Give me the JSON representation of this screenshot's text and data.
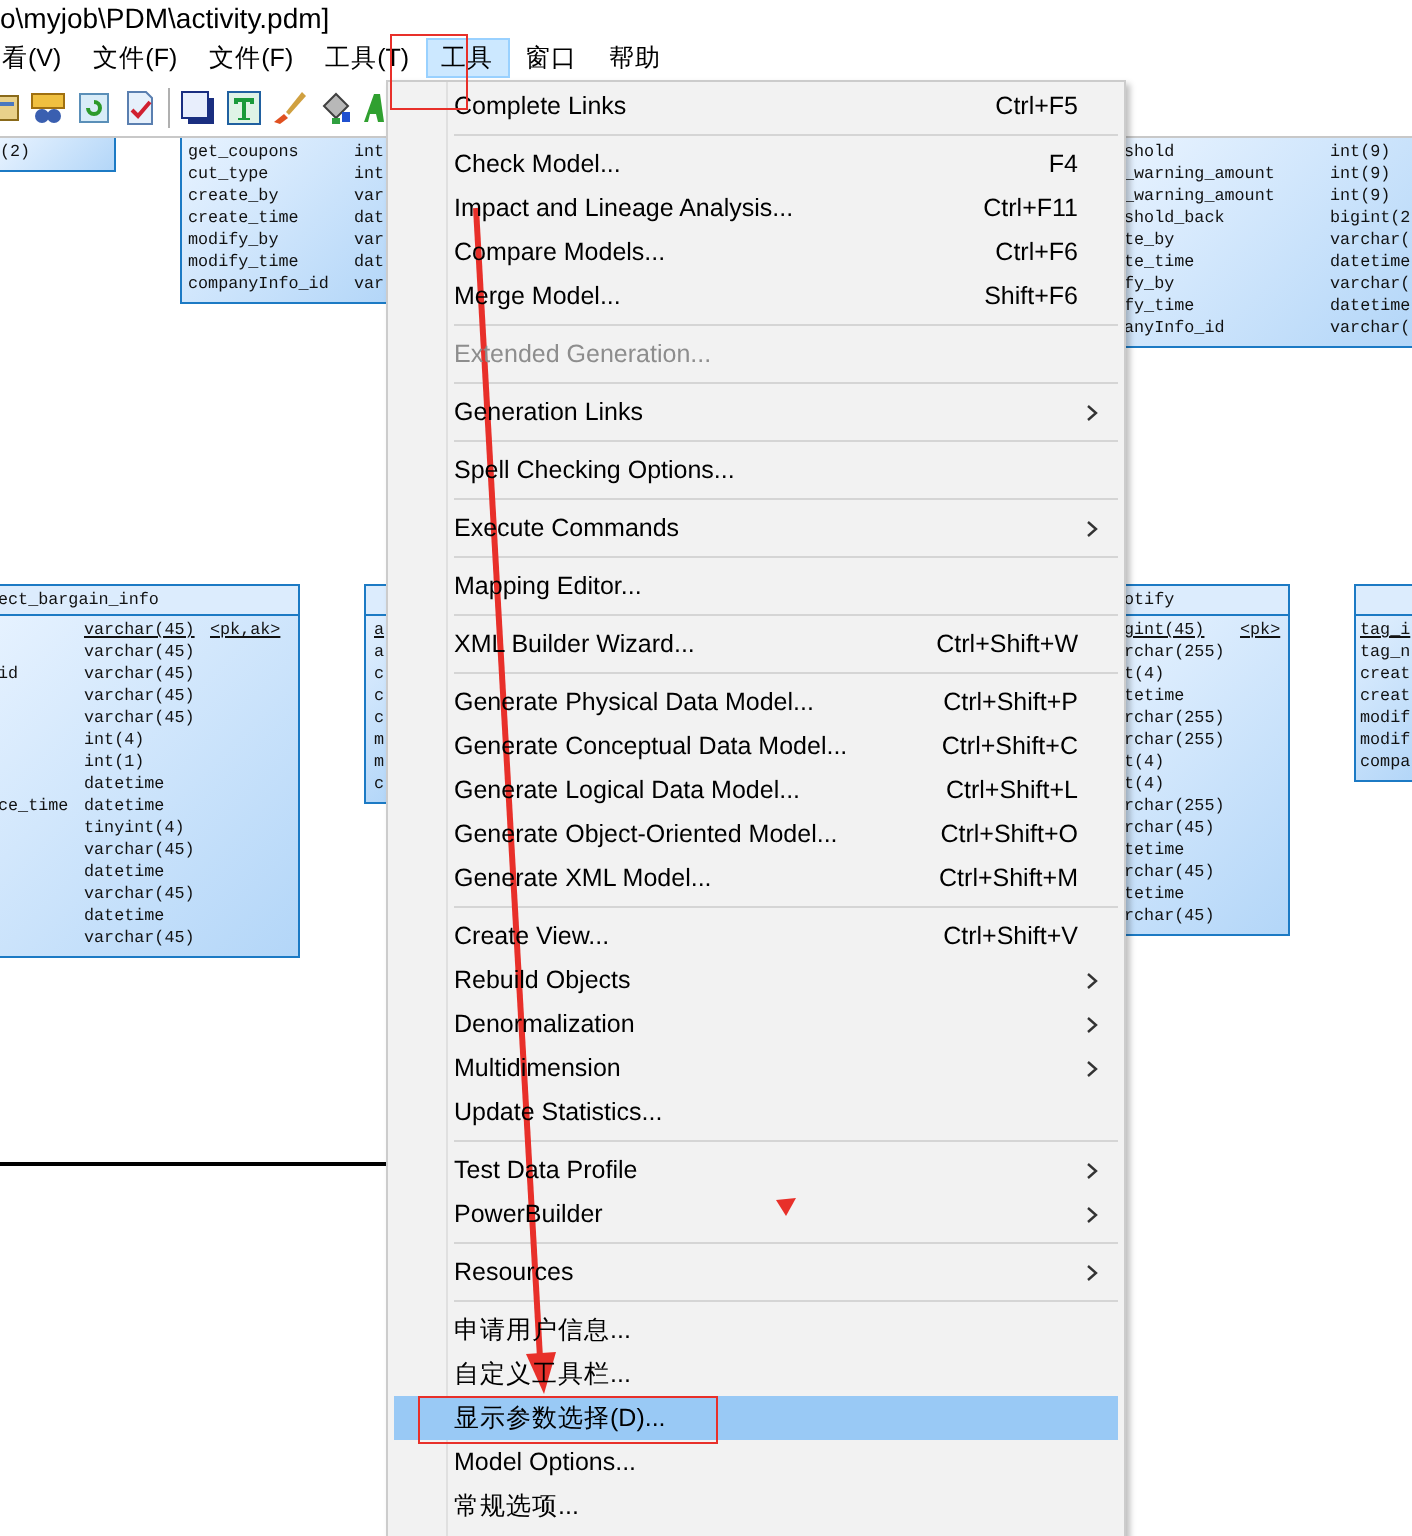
{
  "window": {
    "title": "o\\myjob\\PDM\\activity.pdm]"
  },
  "menu_bar": [
    {
      "label": "看(V)",
      "selected": false
    },
    {
      "label": "文件(F)",
      "selected": false
    },
    {
      "label": "文件(F)",
      "selected": false
    },
    {
      "label": "工具(T)",
      "selected": false
    },
    {
      "label": "工具",
      "selected": true
    },
    {
      "label": "窗口",
      "selected": false
    },
    {
      "label": "帮助",
      "selected": false
    }
  ],
  "diagram": {
    "tables": [
      {
        "rows": [
          {
            "type": "(2)"
          }
        ]
      },
      {
        "rows": [
          {
            "name": "get_coupons",
            "type": "int"
          },
          {
            "name": "cut_type",
            "type": "int"
          },
          {
            "name": "create_by",
            "type": "var"
          },
          {
            "name": "create_time",
            "type": "dat"
          },
          {
            "name": "modify_by",
            "type": "var"
          },
          {
            "name": "modify_time",
            "type": "dat"
          },
          {
            "name": "companyInfo_id",
            "type": "var"
          }
        ]
      },
      {
        "rows": [
          {
            "name": "shold",
            "type": "int(9)"
          },
          {
            "name": "_warning_amount",
            "type": "int(9)"
          },
          {
            "name": "_warning_amount",
            "type": "int(9)"
          },
          {
            "name": "shold_back",
            "type": "bigint(2"
          },
          {
            "name": "te_by",
            "type": "varchar("
          },
          {
            "name": "te_time",
            "type": "datetime"
          },
          {
            "name": "fy_by",
            "type": "varchar("
          },
          {
            "name": "fy_time",
            "type": "datetime"
          },
          {
            "name": "anyInfo_id",
            "type": "varchar("
          }
        ]
      },
      {
        "title": "ect_bargain_info",
        "rows": [
          {
            "type": "varchar(45)",
            "key": "<pk,ak>",
            "primary": true
          },
          {
            "type": "varchar(45)",
            "primary": false
          },
          {
            "name": "id",
            "type": "varchar(45)",
            "primary": false
          },
          {
            "type": "varchar(45)",
            "primary": false
          },
          {
            "type": "varchar(45)",
            "primary": false
          },
          {
            "type": "int(4)",
            "primary": false
          },
          {
            "type": "int(1)",
            "primary": false
          },
          {
            "type": "datetime",
            "primary": false
          },
          {
            "name": "ce_time",
            "type": "datetime",
            "primary": false
          },
          {
            "type": "tinyint(4)",
            "primary": false
          },
          {
            "type": "varchar(45)",
            "primary": false
          },
          {
            "type": "datetime",
            "primary": false
          },
          {
            "type": "varchar(45)",
            "primary": false
          },
          {
            "type": "datetime",
            "primary": false
          },
          {
            "type": "varchar(45)",
            "primary": false
          }
        ]
      },
      {
        "rows": [
          {
            "name": "a",
            "primary": true
          },
          {
            "name": "a",
            "primary": false
          },
          {
            "name": "c",
            "primary": false
          },
          {
            "name": "c",
            "primary": false
          },
          {
            "name": "c",
            "primary": false
          },
          {
            "name": "m",
            "primary": false
          },
          {
            "name": "m",
            "primary": false
          },
          {
            "name": "c",
            "primary": false
          }
        ]
      },
      {
        "title": "otify",
        "rows": [
          {
            "type": "gint(45)",
            "key": "<pk>",
            "primary": true
          },
          {
            "type": "rchar(255)",
            "primary": false
          },
          {
            "type": "t(4)",
            "primary": false
          },
          {
            "type": "tetime",
            "primary": false
          },
          {
            "type": "rchar(255)",
            "primary": false
          },
          {
            "type": "rchar(255)",
            "primary": false
          },
          {
            "type": "t(4)",
            "primary": false
          },
          {
            "type": "t(4)",
            "primary": false
          },
          {
            "type": "rchar(255)",
            "primary": false
          },
          {
            "type": "rchar(45)",
            "primary": false
          },
          {
            "type": "tetime",
            "primary": false
          },
          {
            "type": "rchar(45)",
            "primary": false
          },
          {
            "type": "tetime",
            "primary": false
          },
          {
            "type": "rchar(45)",
            "primary": false
          }
        ]
      },
      {
        "rows": [
          {
            "name": "tag_i",
            "primary": true
          },
          {
            "name": "tag_n",
            "primary": false
          },
          {
            "name": "creat",
            "primary": false
          },
          {
            "name": "creat",
            "primary": false
          },
          {
            "name": "modif",
            "primary": false
          },
          {
            "name": "modif",
            "primary": false
          },
          {
            "name": "compa",
            "primary": false
          }
        ]
      }
    ]
  },
  "menu": {
    "items": [
      {
        "kind": "item",
        "label": "Complete Links",
        "shortcut": "Ctrl+F5",
        "submenu": false,
        "disabled": false,
        "selected": false
      },
      {
        "kind": "separator"
      },
      {
        "kind": "item",
        "label": "Check Model...",
        "shortcut": "F4",
        "submenu": false,
        "disabled": false,
        "selected": false
      },
      {
        "kind": "item",
        "label": "Impact and Lineage Analysis...",
        "shortcut": "Ctrl+F11",
        "submenu": false,
        "disabled": false,
        "selected": false
      },
      {
        "kind": "item",
        "label": "Compare Models...",
        "shortcut": "Ctrl+F6",
        "submenu": false,
        "disabled": false,
        "selected": false
      },
      {
        "kind": "item",
        "label": "Merge Model...",
        "shortcut": "Shift+F6",
        "submenu": false,
        "disabled": false,
        "selected": false
      },
      {
        "kind": "separator"
      },
      {
        "kind": "item",
        "label": "Extended Generation...",
        "submenu": false,
        "disabled": true,
        "selected": false
      },
      {
        "kind": "separator"
      },
      {
        "kind": "item",
        "label": "Generation Links",
        "submenu": true,
        "disabled": false,
        "selected": false
      },
      {
        "kind": "separator"
      },
      {
        "kind": "item",
        "label": "Spell Checking Options...",
        "submenu": false,
        "disabled": false,
        "selected": false
      },
      {
        "kind": "separator"
      },
      {
        "kind": "item",
        "label": "Execute Commands",
        "submenu": true,
        "disabled": false,
        "selected": false
      },
      {
        "kind": "separator"
      },
      {
        "kind": "item",
        "label": "Mapping Editor...",
        "submenu": false,
        "disabled": false,
        "selected": false
      },
      {
        "kind": "separator"
      },
      {
        "kind": "item",
        "label": "XML Builder Wizard...",
        "shortcut": "Ctrl+Shift+W",
        "submenu": false,
        "disabled": false,
        "selected": false
      },
      {
        "kind": "separator"
      },
      {
        "kind": "item",
        "label": "Generate Physical Data Model...",
        "shortcut": "Ctrl+Shift+P",
        "submenu": false,
        "disabled": false,
        "selected": false
      },
      {
        "kind": "item",
        "label": "Generate Conceptual Data Model...",
        "shortcut": "Ctrl+Shift+C",
        "submenu": false,
        "disabled": false,
        "selected": false
      },
      {
        "kind": "item",
        "label": "Generate Logical Data Model...",
        "shortcut": "Ctrl+Shift+L",
        "submenu": false,
        "disabled": false,
        "selected": false
      },
      {
        "kind": "item",
        "label": "Generate Object-Oriented Model...",
        "shortcut": "Ctrl+Shift+O",
        "submenu": false,
        "disabled": false,
        "selected": false
      },
      {
        "kind": "item",
        "label": "Generate XML Model...",
        "shortcut": "Ctrl+Shift+M",
        "submenu": false,
        "disabled": false,
        "selected": false
      },
      {
        "kind": "separator"
      },
      {
        "kind": "item",
        "label": "Create View...",
        "shortcut": "Ctrl+Shift+V",
        "submenu": false,
        "disabled": false,
        "selected": false
      },
      {
        "kind": "item",
        "label": "Rebuild Objects",
        "submenu": true,
        "disabled": false,
        "selected": false
      },
      {
        "kind": "item",
        "label": "Denormalization",
        "submenu": true,
        "disabled": false,
        "selected": false
      },
      {
        "kind": "item",
        "label": "Multidimension",
        "submenu": true,
        "disabled": false,
        "selected": false
      },
      {
        "kind": "item",
        "label": "Update Statistics...",
        "submenu": false,
        "disabled": false,
        "selected": false
      },
      {
        "kind": "separator"
      },
      {
        "kind": "item",
        "label": "Test Data Profile",
        "submenu": true,
        "disabled": false,
        "selected": false
      },
      {
        "kind": "item",
        "label": "PowerBuilder",
        "submenu": true,
        "disabled": false,
        "selected": false
      },
      {
        "kind": "separator"
      },
      {
        "kind": "item",
        "label": "Resources",
        "submenu": true,
        "disabled": false,
        "selected": false
      },
      {
        "kind": "separator"
      },
      {
        "kind": "item",
        "label": "申请用户信息...",
        "submenu": false,
        "disabled": false,
        "selected": false
      },
      {
        "kind": "item",
        "label": "自定义工具栏...",
        "submenu": false,
        "disabled": false,
        "selected": false
      },
      {
        "kind": "item",
        "label": "显示参数选择(D)...",
        "submenu": false,
        "disabled": false,
        "selected": true
      },
      {
        "kind": "item",
        "label": "Model Options...",
        "submenu": false,
        "disabled": false,
        "selected": false
      },
      {
        "kind": "item",
        "label": "常规选项...",
        "submenu": false,
        "disabled": false,
        "selected": false
      }
    ]
  }
}
